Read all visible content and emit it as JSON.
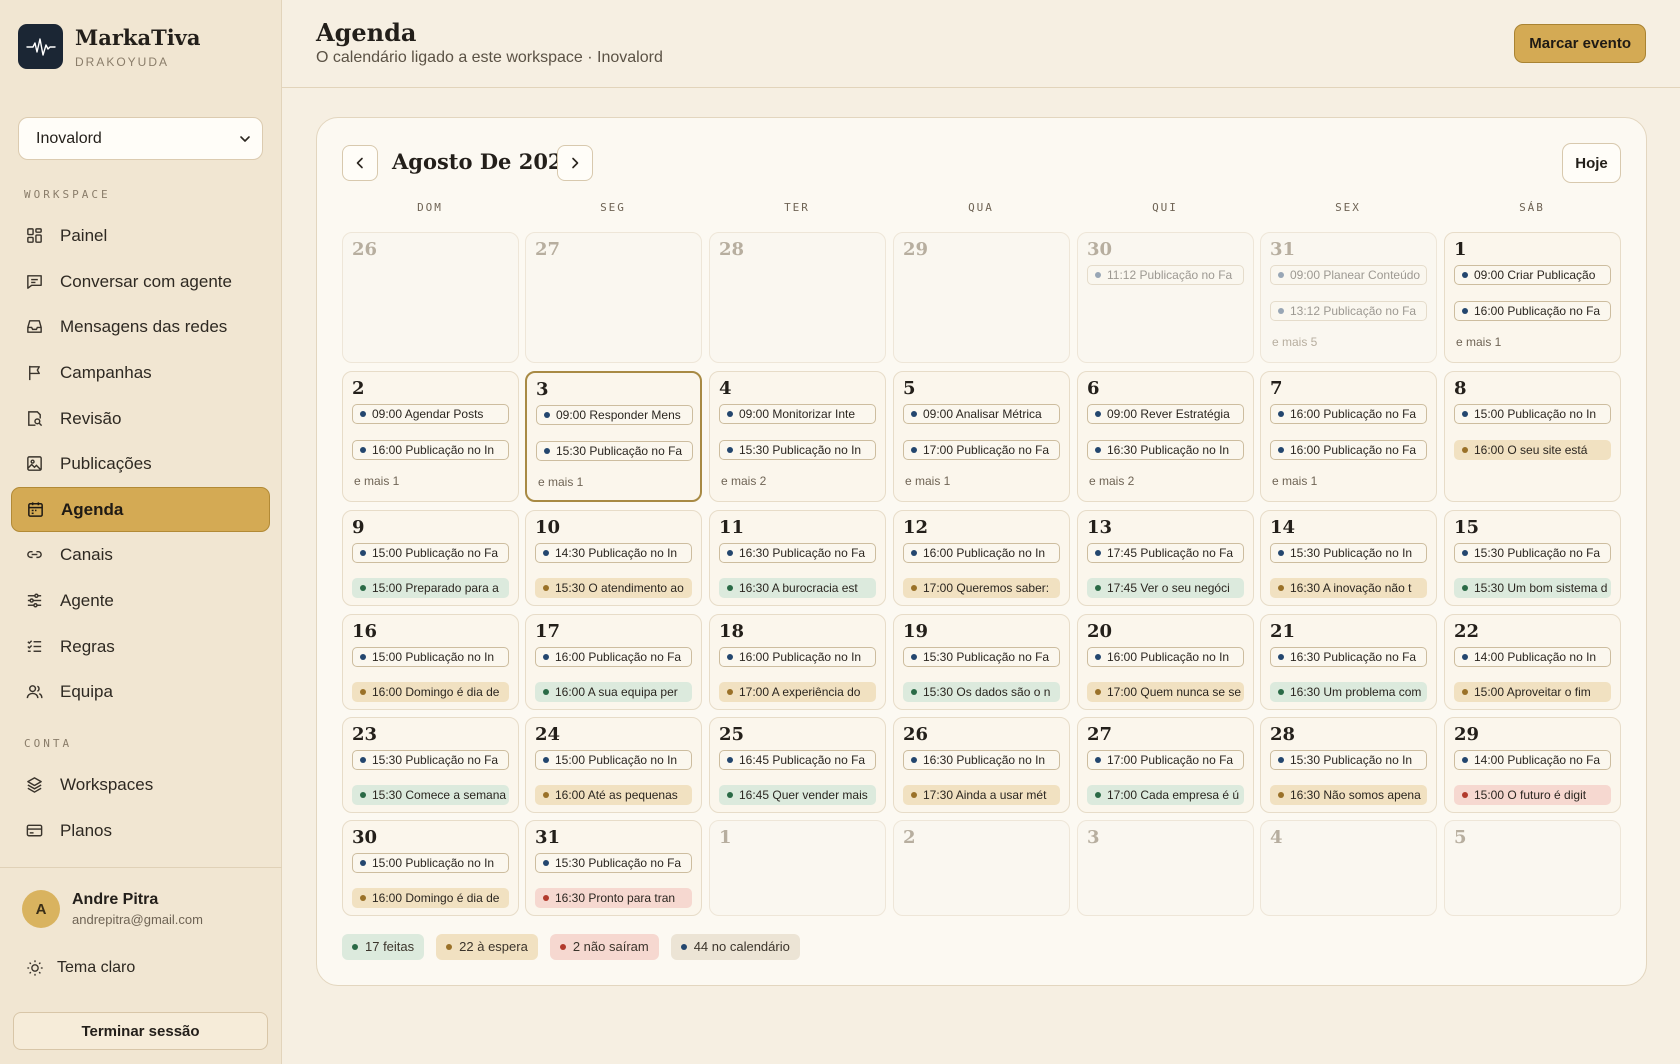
{
  "brand": {
    "name": "MarkaTiva",
    "subtitle": "DRAKOYUDA"
  },
  "workspace_select": {
    "value": "Inovalord"
  },
  "sidebar": {
    "section_workspace": "WORKSPACE",
    "section_account": "CONTA",
    "items": [
      {
        "label": "Painel",
        "icon": "grid-icon"
      },
      {
        "label": "Conversar com agente",
        "icon": "chat-icon"
      },
      {
        "label": "Mensagens das redes",
        "icon": "inbox-icon"
      },
      {
        "label": "Campanhas",
        "icon": "flag-icon"
      },
      {
        "label": "Revisão",
        "icon": "review-icon"
      },
      {
        "label": "Publicações",
        "icon": "image-icon"
      },
      {
        "label": "Agenda",
        "icon": "calendar-icon",
        "active": true
      },
      {
        "label": "Canais",
        "icon": "link-icon"
      },
      {
        "label": "Agente",
        "icon": "sliders-icon"
      },
      {
        "label": "Regras",
        "icon": "list-check-icon"
      },
      {
        "label": "Equipa",
        "icon": "users-icon"
      }
    ],
    "account_items": [
      {
        "label": "Workspaces",
        "icon": "layers-icon"
      },
      {
        "label": "Planos",
        "icon": "card-icon"
      }
    ]
  },
  "user": {
    "initial": "A",
    "name": "Andre Pitra",
    "email": "andrepitra@gmail.com"
  },
  "theme_toggle": {
    "label": "Tema claro"
  },
  "logout": {
    "label": "Terminar sessão"
  },
  "header": {
    "title": "Agenda",
    "subtitle": "O calendário ligado a este workspace · Inovalord",
    "primary_button": "Marcar evento"
  },
  "calendar": {
    "month_title": "Agosto De 2026",
    "today_button": "Hoje",
    "weekdays": [
      "DOM",
      "SEG",
      "TER",
      "QUA",
      "QUI",
      "SEX",
      "SÁB"
    ],
    "weeks": [
      [
        {
          "day": "26",
          "muted": true,
          "events": []
        },
        {
          "day": "27",
          "muted": true,
          "events": []
        },
        {
          "day": "28",
          "muted": true,
          "events": []
        },
        {
          "day": "29",
          "muted": true,
          "events": []
        },
        {
          "day": "30",
          "muted": true,
          "events": [
            {
              "text": "11:12 Publicação no Fa",
              "status": "pub"
            }
          ]
        },
        {
          "day": "31",
          "muted": true,
          "events": [
            {
              "text": "09:00 Planear Conteúdo",
              "status": "pub"
            },
            {
              "text": "13:12 Publicação no Fa",
              "status": "pub"
            }
          ],
          "more": "e mais 5"
        },
        {
          "day": "1",
          "events": [
            {
              "text": "09:00 Criar Publicação",
              "status": "pub"
            },
            {
              "text": "16:00 Publicação no Fa",
              "status": "pub"
            }
          ],
          "more": "e mais 1"
        }
      ],
      [
        {
          "day": "2",
          "events": [
            {
              "text": "09:00 Agendar Posts",
              "status": "pub"
            },
            {
              "text": "16:00 Publicação no In",
              "status": "pub"
            }
          ],
          "more": "e mais 1"
        },
        {
          "day": "3",
          "today": true,
          "events": [
            {
              "text": "09:00 Responder Mens",
              "status": "pub"
            },
            {
              "text": "15:30 Publicação no Fa",
              "status": "pub"
            }
          ],
          "more": "e mais 1"
        },
        {
          "day": "4",
          "events": [
            {
              "text": "09:00 Monitorizar Inte",
              "status": "pub"
            },
            {
              "text": "15:30 Publicação no In",
              "status": "pub"
            }
          ],
          "more": "e mais 2"
        },
        {
          "day": "5",
          "events": [
            {
              "text": "09:00 Analisar Métrica",
              "status": "pub"
            },
            {
              "text": "17:00 Publicação no Fa",
              "status": "pub"
            }
          ],
          "more": "e mais 1"
        },
        {
          "day": "6",
          "events": [
            {
              "text": "09:00 Rever Estratégia",
              "status": "pub"
            },
            {
              "text": "16:30 Publicação no In",
              "status": "pub"
            }
          ],
          "more": "e mais 2"
        },
        {
          "day": "7",
          "events": [
            {
              "text": "16:00 Publicação no Fa",
              "status": "pub"
            },
            {
              "text": "16:00 Publicação no Fa",
              "status": "pub"
            }
          ],
          "more": "e mais 1"
        },
        {
          "day": "8",
          "events": [
            {
              "text": "15:00 Publicação no In",
              "status": "pub"
            },
            {
              "text": "16:00 O seu site está",
              "status": "pend"
            }
          ]
        }
      ],
      [
        {
          "day": "9",
          "events": [
            {
              "text": "15:00 Publicação no Fa",
              "status": "pub"
            },
            {
              "text": "15:00 Preparado para a",
              "status": "ok"
            }
          ]
        },
        {
          "day": "10",
          "events": [
            {
              "text": "14:30 Publicação no In",
              "status": "pub"
            },
            {
              "text": "15:30 O atendimento ao",
              "status": "pend"
            }
          ]
        },
        {
          "day": "11",
          "events": [
            {
              "text": "16:30 Publicação no Fa",
              "status": "pub"
            },
            {
              "text": "16:30 A burocracia est",
              "status": "ok"
            }
          ]
        },
        {
          "day": "12",
          "events": [
            {
              "text": "16:00 Publicação no In",
              "status": "pub"
            },
            {
              "text": "17:00 Queremos saber:",
              "status": "pend"
            }
          ]
        },
        {
          "day": "13",
          "events": [
            {
              "text": "17:45 Publicação no Fa",
              "status": "pub"
            },
            {
              "text": "17:45 Ver o seu negóci",
              "status": "ok"
            }
          ]
        },
        {
          "day": "14",
          "events": [
            {
              "text": "15:30 Publicação no In",
              "status": "pub"
            },
            {
              "text": "16:30 A inovação não t",
              "status": "pend"
            }
          ]
        },
        {
          "day": "15",
          "events": [
            {
              "text": "15:30 Publicação no Fa",
              "status": "pub"
            },
            {
              "text": "15:30 Um bom sistema d",
              "status": "ok"
            }
          ]
        }
      ],
      [
        {
          "day": "16",
          "events": [
            {
              "text": "15:00 Publicação no In",
              "status": "pub"
            },
            {
              "text": "16:00 Domingo é dia de",
              "status": "pend"
            }
          ]
        },
        {
          "day": "17",
          "events": [
            {
              "text": "16:00 Publicação no Fa",
              "status": "pub"
            },
            {
              "text": "16:00 A sua equipa per",
              "status": "ok"
            }
          ]
        },
        {
          "day": "18",
          "events": [
            {
              "text": "16:00 Publicação no In",
              "status": "pub"
            },
            {
              "text": "17:00 A experiência do",
              "status": "pend"
            }
          ]
        },
        {
          "day": "19",
          "events": [
            {
              "text": "15:30 Publicação no Fa",
              "status": "pub"
            },
            {
              "text": "15:30 Os dados são o n",
              "status": "ok"
            }
          ]
        },
        {
          "day": "20",
          "events": [
            {
              "text": "16:00 Publicação no In",
              "status": "pub"
            },
            {
              "text": "17:00 Quem nunca se se",
              "status": "pend"
            }
          ]
        },
        {
          "day": "21",
          "events": [
            {
              "text": "16:30 Publicação no Fa",
              "status": "pub"
            },
            {
              "text": "16:30 Um problema com",
              "status": "ok"
            }
          ]
        },
        {
          "day": "22",
          "events": [
            {
              "text": "14:00 Publicação no In",
              "status": "pub"
            },
            {
              "text": "15:00 Aproveitar o fim",
              "status": "pend"
            }
          ]
        }
      ],
      [
        {
          "day": "23",
          "events": [
            {
              "text": "15:30 Publicação no Fa",
              "status": "pub"
            },
            {
              "text": "15:30 Comece a semana",
              "status": "ok"
            }
          ]
        },
        {
          "day": "24",
          "events": [
            {
              "text": "15:00 Publicação no In",
              "status": "pub"
            },
            {
              "text": "16:00 Até as pequenas",
              "status": "pend"
            }
          ]
        },
        {
          "day": "25",
          "events": [
            {
              "text": "16:45 Publicação no Fa",
              "status": "pub"
            },
            {
              "text": "16:45 Quer vender mais",
              "status": "ok"
            }
          ]
        },
        {
          "day": "26",
          "events": [
            {
              "text": "16:30 Publicação no In",
              "status": "pub"
            },
            {
              "text": "17:30 Ainda a usar mét",
              "status": "pend"
            }
          ]
        },
        {
          "day": "27",
          "events": [
            {
              "text": "17:00 Publicação no Fa",
              "status": "pub"
            },
            {
              "text": "17:00 Cada empresa é ú",
              "status": "ok"
            }
          ]
        },
        {
          "day": "28",
          "events": [
            {
              "text": "15:30 Publicação no In",
              "status": "pub"
            },
            {
              "text": "16:30 Não somos apena",
              "status": "pend"
            }
          ]
        },
        {
          "day": "29",
          "events": [
            {
              "text": "14:00 Publicação no Fa",
              "status": "pub"
            },
            {
              "text": "15:00 O futuro é digit",
              "status": "fail"
            }
          ]
        }
      ],
      [
        {
          "day": "30",
          "events": [
            {
              "text": "15:00 Publicação no In",
              "status": "pub"
            },
            {
              "text": "16:00 Domingo é dia de",
              "status": "pend"
            }
          ]
        },
        {
          "day": "31",
          "events": [
            {
              "text": "15:30 Publicação no Fa",
              "status": "pub"
            },
            {
              "text": "16:30 Pronto para tran",
              "status": "fail"
            }
          ]
        },
        {
          "day": "1",
          "muted": true,
          "events": []
        },
        {
          "day": "2",
          "muted": true,
          "events": []
        },
        {
          "day": "3",
          "muted": true,
          "events": []
        },
        {
          "day": "4",
          "muted": true,
          "events": []
        },
        {
          "day": "5",
          "muted": true,
          "events": []
        }
      ]
    ],
    "legend": [
      {
        "text": "17 feitas",
        "status": "ok"
      },
      {
        "text": "22 à espera",
        "status": "pend"
      },
      {
        "text": "2 não saíram",
        "status": "fail"
      },
      {
        "text": "44 no calendário",
        "status": "cal"
      }
    ]
  },
  "colors": {
    "accent": "#d4aa54",
    "sidebar_bg": "#f1e6d2",
    "page_bg": "#f6efe2",
    "published_dot": "#23466e",
    "done": "#dceadd",
    "pending": "#f1e1c1",
    "failed": "#f6d8d0"
  }
}
